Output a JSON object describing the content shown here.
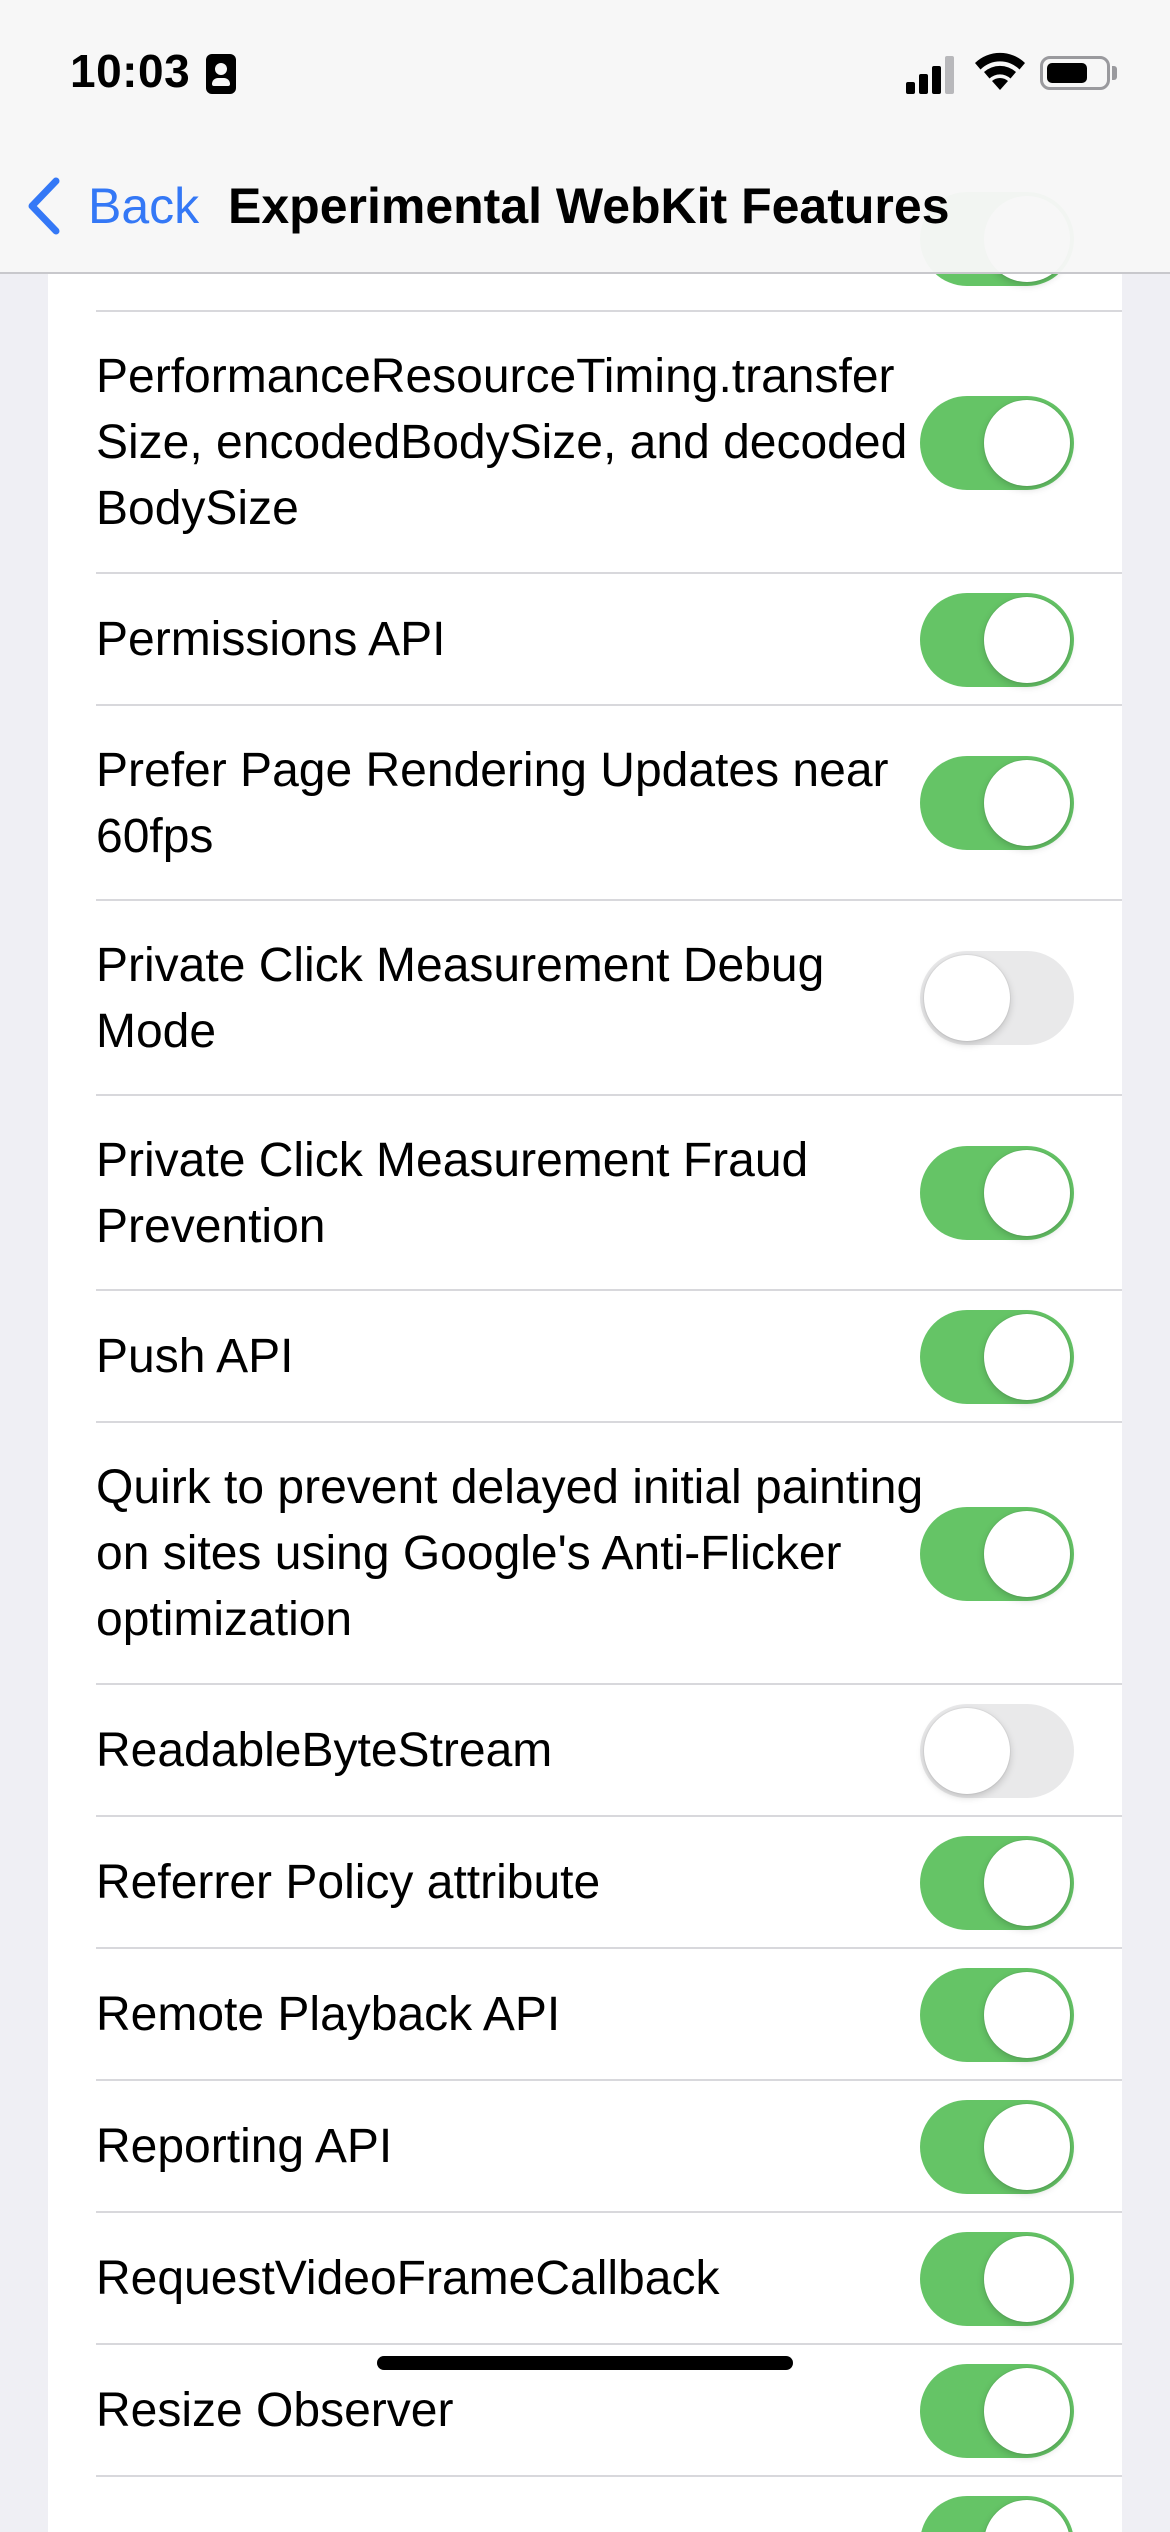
{
  "status_bar": {
    "time": "10:03"
  },
  "nav": {
    "back_label": "Back",
    "title": "Experimental WebKit Features"
  },
  "settings": [
    {
      "label": "",
      "on": true
    },
    {
      "label": "PerformanceResourceTiming.transferSize, encodedBodySize, and decodedBodySize",
      "on": true
    },
    {
      "label": "Permissions API",
      "on": true
    },
    {
      "label": "Prefer Page Rendering Updates near 60fps",
      "on": true
    },
    {
      "label": "Private Click Measurement Debug Mode",
      "on": false
    },
    {
      "label": "Private Click Measurement Fraud Prevention",
      "on": true
    },
    {
      "label": "Push API",
      "on": true
    },
    {
      "label": "Quirk to prevent delayed initial painting on sites using Google's Anti-Flicker optimization",
      "on": true
    },
    {
      "label": "ReadableByteStream",
      "on": false
    },
    {
      "label": "Referrer Policy attribute",
      "on": true
    },
    {
      "label": "Remote Playback API",
      "on": true
    },
    {
      "label": "Reporting API",
      "on": true
    },
    {
      "label": "RequestVideoFrameCallback",
      "on": true
    },
    {
      "label": "Resize Observer",
      "on": true
    },
    {
      "label": "",
      "on": true
    }
  ],
  "colors": {
    "accent": "#3478f6",
    "switch_on": "#65c466",
    "switch_off": "#e9e9ea"
  }
}
